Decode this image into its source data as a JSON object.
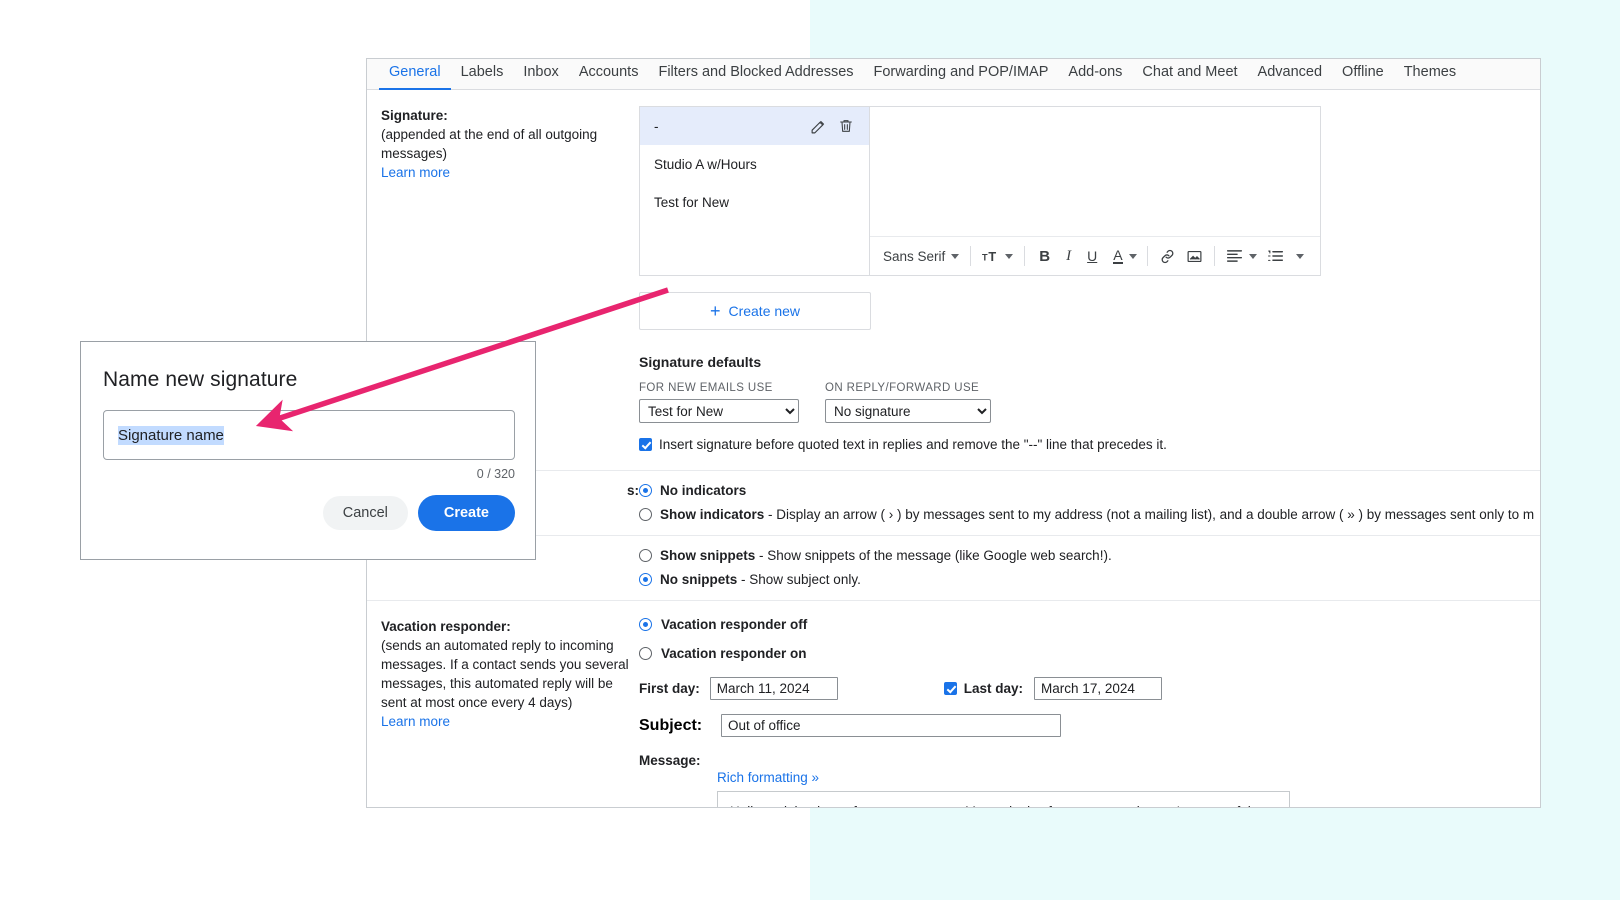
{
  "colors": {
    "accent": "#1a73e8",
    "arrow": "#e8256f",
    "page_band": "#e9fbfb",
    "selection": "#c2dbff",
    "selected_row": "#e5ecfb"
  },
  "tabs": [
    {
      "label": "General",
      "active": true
    },
    {
      "label": "Labels",
      "active": false
    },
    {
      "label": "Inbox",
      "active": false
    },
    {
      "label": "Accounts",
      "active": false
    },
    {
      "label": "Filters and Blocked Addresses",
      "active": false
    },
    {
      "label": "Forwarding and POP/IMAP",
      "active": false
    },
    {
      "label": "Add-ons",
      "active": false
    },
    {
      "label": "Chat and Meet",
      "active": false
    },
    {
      "label": "Advanced",
      "active": false
    },
    {
      "label": "Offline",
      "active": false
    },
    {
      "label": "Themes",
      "active": false
    }
  ],
  "signature": {
    "label": "Signature:",
    "description": "(appended at the end of all outgoing messages)",
    "learn_more": "Learn more",
    "items": [
      {
        "name": "-",
        "selected": true
      },
      {
        "name": "Studio A w/Hours",
        "selected": false
      },
      {
        "name": "Test for New",
        "selected": false
      }
    ],
    "edit_icon": "pencil-icon",
    "delete_icon": "trash-icon",
    "create_new": "Create new",
    "toolbar": {
      "font_family": "Sans Serif",
      "font_size_icon": "font-size-icon",
      "bold": "B",
      "italic": "I",
      "underline": "U",
      "text_color": "A",
      "link_icon": "link-icon",
      "image_icon": "image-icon",
      "align_icon": "align-icon",
      "list_icon": "numbered-list-icon",
      "more_icon": "more-options-icon"
    },
    "defaults": {
      "title": "Signature defaults",
      "new_emails_caption": "FOR NEW EMAILS USE",
      "new_emails_value": "Test for New",
      "new_emails_options": [
        "No signature",
        "-",
        "Studio A w/Hours",
        "Test for New"
      ],
      "reply_caption": "ON REPLY/FORWARD USE",
      "reply_value": "No signature",
      "reply_options": [
        "No signature",
        "-",
        "Studio A w/Hours",
        "Test for New"
      ],
      "insert_checkbox_checked": true,
      "insert_checkbox_label": "Insert signature before quoted text in replies and remove the \"--\" line that precedes it."
    }
  },
  "personal_indicators": {
    "label_partial": "s:",
    "options": [
      {
        "bold": "No indicators",
        "rest": "",
        "selected": true
      },
      {
        "bold": "Show indicators",
        "rest": " - Display an arrow ( › ) by messages sent to my address (not a mailing list), and a double arrow ( » ) by messages sent only to m",
        "selected": false
      }
    ]
  },
  "snippets": {
    "options": [
      {
        "bold": "Show snippets",
        "rest": " - Show snippets of the message (like Google web search!).",
        "selected": false
      },
      {
        "bold": "No snippets",
        "rest": " - Show subject only.",
        "selected": true
      }
    ]
  },
  "vacation": {
    "label": "Vacation responder:",
    "description": "(sends an automated reply to incoming messages. If a contact sends you several messages, this automated reply will be sent at most once every 4 days)",
    "learn_more": "Learn more",
    "options": [
      {
        "label": "Vacation responder off",
        "selected": true
      },
      {
        "label": "Vacation responder on",
        "selected": false
      }
    ],
    "first_day_label": "First day:",
    "first_day_value": "March 11, 2024",
    "last_day_checked": true,
    "last_day_label": "Last day:",
    "last_day_value": "March 17, 2024",
    "subject_label": "Subject:",
    "subject_value": "Out of office",
    "message_label": "Message:",
    "rich_formatting": "Rich formatting »",
    "message_value": "Hello and thank you for your message. My apologies for any convenience. I am out of the office and have limited access to email through Sunday, March 17th. Please know I will reply when I return."
  },
  "dialog": {
    "title": "Name new signature",
    "input_value": "Signature name",
    "input_placeholder": "Signature name",
    "counter": "0 / 320",
    "cancel_label": "Cancel",
    "create_label": "Create"
  }
}
